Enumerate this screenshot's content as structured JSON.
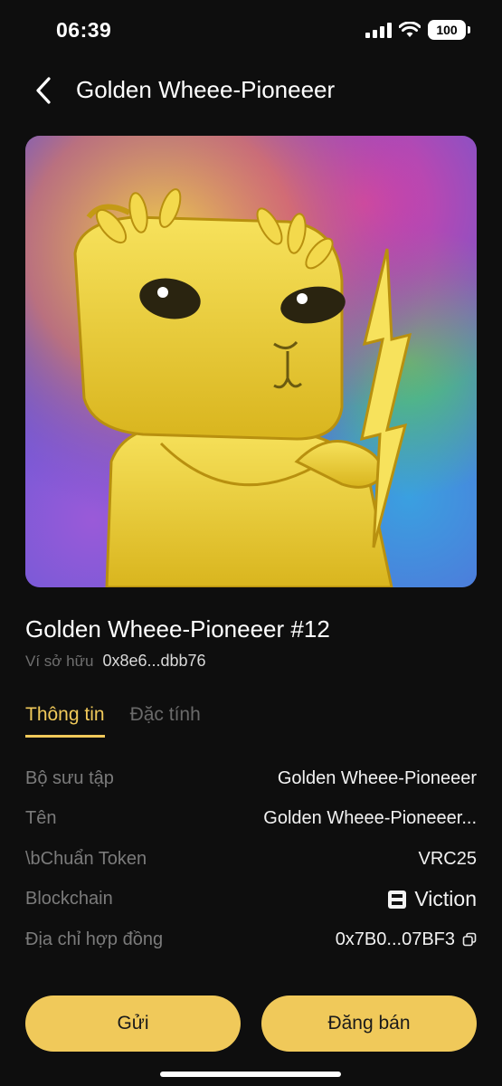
{
  "status_bar": {
    "time": "06:39",
    "battery": "100"
  },
  "header": {
    "title": "Golden Wheee-Pioneeer"
  },
  "nft": {
    "name": "Golden Wheee-Pioneeer #12",
    "owner_label": "Ví sở hữu",
    "owner_value": "0x8e6...dbb76"
  },
  "tabs": [
    {
      "label": "Thông tin",
      "active": true
    },
    {
      "label": "Đặc tính",
      "active": false
    }
  ],
  "info_rows": [
    {
      "label": "Bộ sưu tập",
      "value": "Golden Wheee-Pioneeer"
    },
    {
      "label": "Tên",
      "value": "Golden Wheee-Pioneeer..."
    },
    {
      "label": "\\bChuẩn Token",
      "value": "VRC25"
    },
    {
      "label": "Blockchain",
      "value": "Viction",
      "icon": "viction-logo-icon"
    },
    {
      "label": "Địa chỉ hợp đồng",
      "value": "0x7B0...07BF3",
      "icon": "copy-icon"
    }
  ],
  "actions": {
    "send_label": "Gửi",
    "sell_label": "Đăng bán"
  },
  "colors": {
    "accent": "#f0c95a",
    "background": "#0e0e0e",
    "muted_text": "#7b7b7b"
  }
}
